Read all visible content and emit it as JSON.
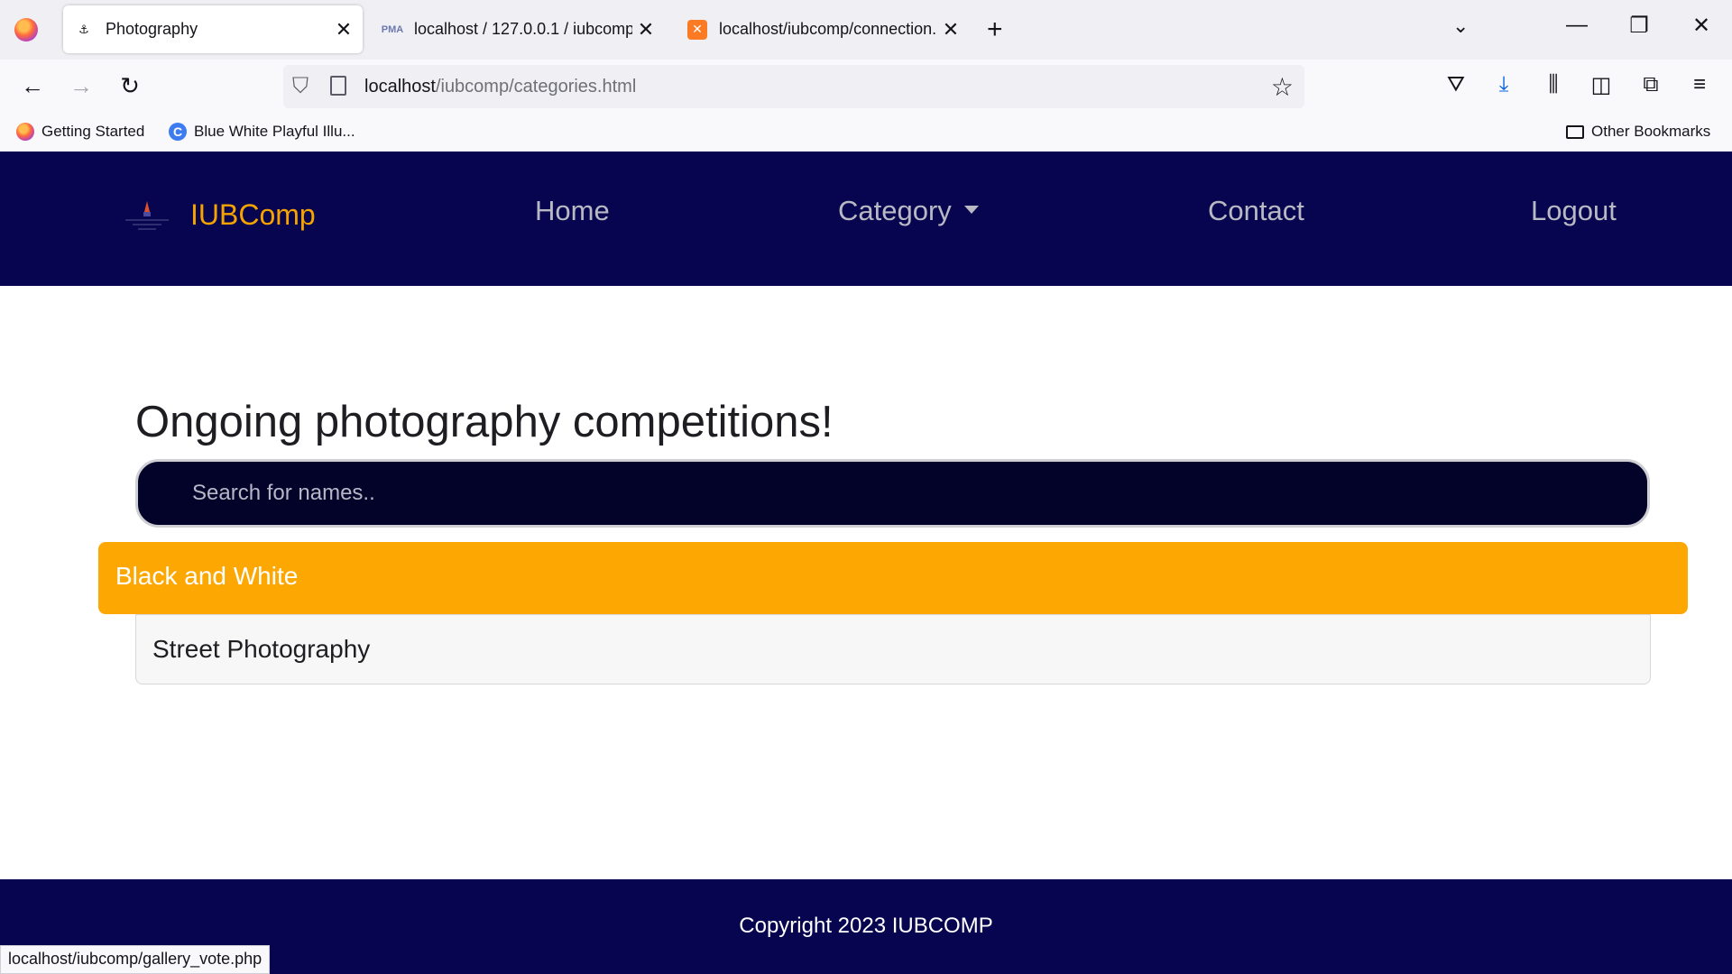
{
  "browser": {
    "tabs": [
      {
        "title": "Photography",
        "favicon": "site-logo-icon",
        "active": true
      },
      {
        "title": "localhost / 127.0.0.1 / iubcomp",
        "favicon": "phpmyadmin-icon",
        "active": false
      },
      {
        "title": "localhost/iubcomp/connection.p",
        "favicon": "xampp-icon",
        "active": false
      }
    ],
    "url_host": "localhost",
    "url_path": "/iubcomp/categories.html",
    "bookmarks": [
      {
        "label": "Getting Started",
        "icon": "firefox-icon"
      },
      {
        "label": "Blue White Playful Illu...",
        "icon": "canva-icon"
      }
    ],
    "other_bookmarks": "Other Bookmarks",
    "status_url": "localhost/iubcomp/gallery_vote.php"
  },
  "site": {
    "brand": "IUBComp",
    "nav": [
      "Home",
      "Category",
      "Contact",
      "Logout"
    ],
    "heading": "Ongoing photography competitions!",
    "search_placeholder": "Search for names..",
    "categories": [
      "Black and White",
      "Street Photography"
    ],
    "footer": "Copyright 2023 IUBCOMP"
  },
  "colors": {
    "header_bg": "#07054f",
    "brand_color": "#f5a300",
    "active_category_bg": "#fca702",
    "search_bg": "#03032a"
  }
}
